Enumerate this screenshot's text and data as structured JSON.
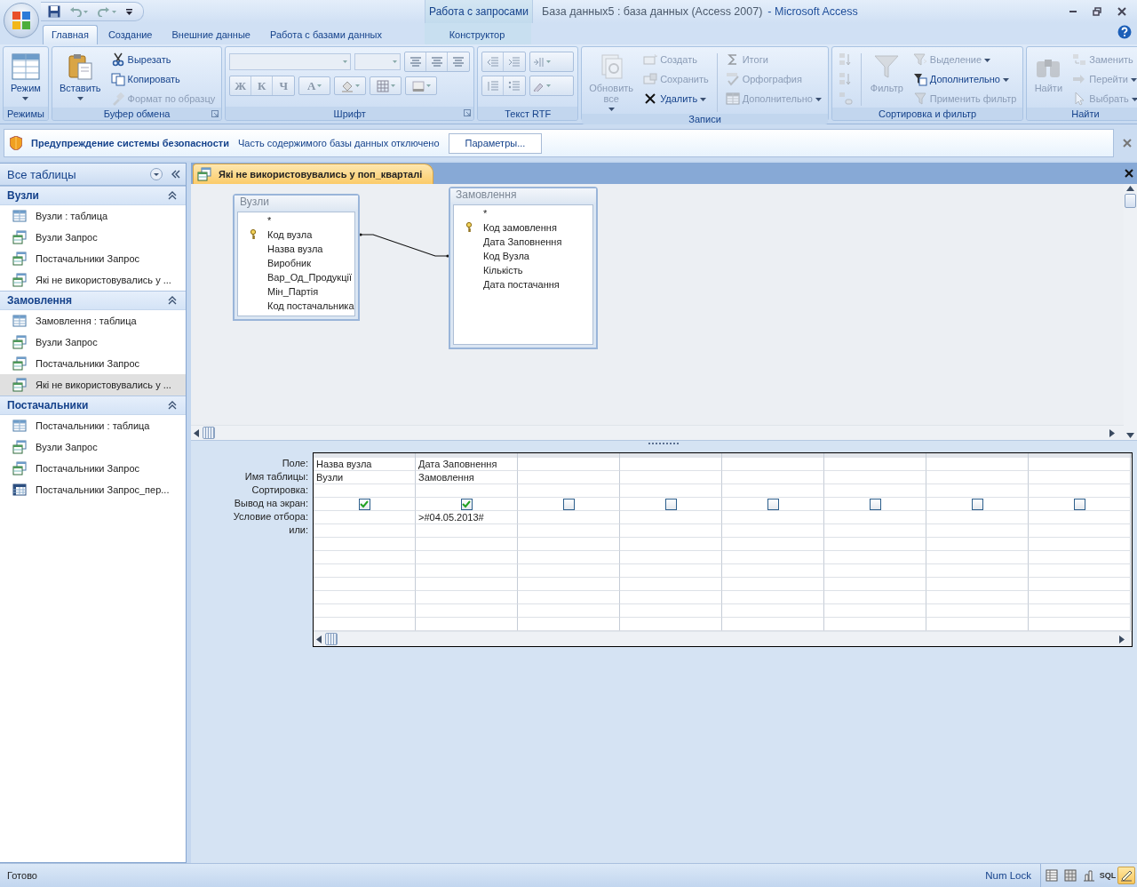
{
  "window": {
    "title": "База данных5 : база данных (Access 2007)",
    "app_name": "- Microsoft Access",
    "context_label": "Работа с запросами"
  },
  "tabs": [
    {
      "label": "Главная",
      "selected": true,
      "kind": "main"
    },
    {
      "label": "Создание",
      "selected": false,
      "kind": "main"
    },
    {
      "label": "Внешние данные",
      "selected": false,
      "kind": "main"
    },
    {
      "label": "Работа с базами данных",
      "selected": false,
      "kind": "main"
    },
    {
      "label": "Конструктор",
      "selected": false,
      "kind": "context"
    }
  ],
  "ribbon": {
    "groups": [
      {
        "label": "Режимы",
        "kind": "commands",
        "items": [
          {
            "label": "Режим",
            "kind": "large",
            "dropdown": true,
            "disabled": false
          }
        ]
      },
      {
        "label": "Буфер обмена",
        "kind": "commands",
        "dialog_launcher": true,
        "items": [
          {
            "label": "Вставить",
            "kind": "large",
            "dropdown": true,
            "disabled": false
          },
          {
            "label": "Вырезать",
            "kind": "small",
            "disabled": false
          },
          {
            "label": "Копировать",
            "kind": "small",
            "disabled": false
          },
          {
            "label": "Формат по образцу",
            "kind": "small",
            "disabled": true
          }
        ]
      },
      {
        "label": "Шрифт",
        "kind": "font",
        "dialog_launcher": true,
        "buttons": [
          {
            "label": "Ж",
            "disabled": true
          },
          {
            "label": "К",
            "disabled": true
          },
          {
            "label": "Ч",
            "disabled": true
          },
          {
            "label": "A",
            "disabled": true
          }
        ]
      },
      {
        "label": "Текст RTF",
        "kind": "rtf"
      },
      {
        "label": "Записи",
        "kind": "commands",
        "items": [
          {
            "label": "Обновить все",
            "kind": "large",
            "dropdown": true,
            "disabled": true
          },
          {
            "label": "Создать",
            "kind": "small",
            "disabled": true
          },
          {
            "label": "Сохранить",
            "kind": "small",
            "disabled": true
          },
          {
            "label": "Удалить",
            "kind": "small",
            "dropdown": true,
            "disabled": false
          },
          {
            "label": "Итоги",
            "kind": "small",
            "disabled": true
          },
          {
            "label": "Орфография",
            "kind": "small",
            "disabled": true
          },
          {
            "label": "Дополнительно",
            "kind": "small",
            "dropdown": true,
            "disabled": true
          }
        ]
      },
      {
        "label": "Сортировка и фильтр",
        "kind": "commands",
        "items": [
          {
            "kind": "icon",
            "disabled": true
          },
          {
            "kind": "icon",
            "disabled": true
          },
          {
            "kind": "icon",
            "disabled": true
          },
          {
            "label": "Фильтр",
            "kind": "large",
            "disabled": true
          },
          {
            "label": "Выделение",
            "kind": "small",
            "dropdown": true,
            "disabled": true
          },
          {
            "label": "Дополнительно",
            "kind": "small",
            "dropdown": true,
            "disabled": false
          },
          {
            "label": "Применить фильтр",
            "kind": "small",
            "disabled": true
          }
        ]
      },
      {
        "label": "Найти",
        "kind": "commands",
        "items": [
          {
            "label": "Найти",
            "kind": "large",
            "disabled": true
          },
          {
            "label": "Заменить",
            "kind": "small",
            "disabled": true
          },
          {
            "label": "Перейти",
            "kind": "small",
            "dropdown": true,
            "disabled": true
          },
          {
            "label": "Выбрать",
            "kind": "small",
            "dropdown": true,
            "disabled": true
          }
        ]
      }
    ]
  },
  "security_bar": {
    "title": "Предупреждение системы безопасности",
    "message": "Часть содержимого базы данных отключено",
    "button": "Параметры..."
  },
  "navigation": {
    "title": "Все таблицы",
    "groups": [
      {
        "label": "Вузли",
        "expanded": true,
        "items": [
          {
            "label": "Вузли : таблица",
            "kind": "table",
            "selected": false
          },
          {
            "label": "Вузли Запрос",
            "kind": "query",
            "selected": false
          },
          {
            "label": "Постачальники Запрос",
            "kind": "query",
            "selected": false
          },
          {
            "label": "Які не використовувались у ...",
            "kind": "query",
            "selected": false
          }
        ]
      },
      {
        "label": "Замовлення",
        "expanded": true,
        "items": [
          {
            "label": "Замовлення : таблица",
            "kind": "table",
            "selected": false
          },
          {
            "label": "Вузли Запрос",
            "kind": "query",
            "selected": false
          },
          {
            "label": "Постачальники Запрос",
            "kind": "query",
            "selected": false
          },
          {
            "label": "Які не використовувались у ...",
            "kind": "query",
            "selected": true
          }
        ]
      },
      {
        "label": "Постачальники",
        "expanded": true,
        "items": [
          {
            "label": "Постачальники : таблица",
            "kind": "table",
            "selected": false
          },
          {
            "label": "Вузли Запрос",
            "kind": "query",
            "selected": false
          },
          {
            "label": "Постачальники Запрос",
            "kind": "query",
            "selected": false
          },
          {
            "label": "Постачальники Запрос_пер...",
            "kind": "crosstab",
            "selected": false
          }
        ]
      }
    ]
  },
  "document": {
    "tab": "Які не використовувались у поп_кварталі",
    "tables": [
      {
        "title": "Вузли",
        "fields": [
          {
            "label": "*"
          },
          {
            "label": "Код вузла",
            "key": true
          },
          {
            "label": "Назва вузла"
          },
          {
            "label": "Виробник"
          },
          {
            "label": "Вар_Од_Продукції"
          },
          {
            "label": "Мін_Партія"
          },
          {
            "label": "Код постачальника"
          }
        ]
      },
      {
        "title": "Замовлення",
        "fields": [
          {
            "label": "*"
          },
          {
            "label": "Код замовлення",
            "key": true
          },
          {
            "label": "Дата Заповнення"
          },
          {
            "label": "Код Вузла"
          },
          {
            "label": "Кількість"
          },
          {
            "label": "Дата постачання"
          }
        ]
      }
    ],
    "grid": {
      "row_labels": [
        "Поле:",
        "Имя таблицы:",
        "Сортировка:",
        "Вывод на экран:",
        "Условие отбора:",
        "или:"
      ],
      "columns": [
        {
          "field": "Назва вузла",
          "table": "Вузли",
          "show": true
        },
        {
          "field": "Дата Заповнення",
          "table": "Замовлення",
          "show": true,
          "criteria": ">#04.05.2013#"
        },
        {
          "show": false
        },
        {
          "show": false
        },
        {
          "show": false
        },
        {
          "show": false
        },
        {
          "show": false
        },
        {
          "show": false
        }
      ]
    }
  },
  "status_bar": {
    "status": "Готово",
    "indicator": "Num Lock",
    "views": [
      {
        "kind": "datasheet",
        "selected": false
      },
      {
        "kind": "pivot",
        "selected": false
      },
      {
        "kind": "chart",
        "selected": false
      },
      {
        "kind": "sql",
        "label": "SQL",
        "selected": false
      },
      {
        "kind": "design",
        "selected": true
      }
    ]
  }
}
